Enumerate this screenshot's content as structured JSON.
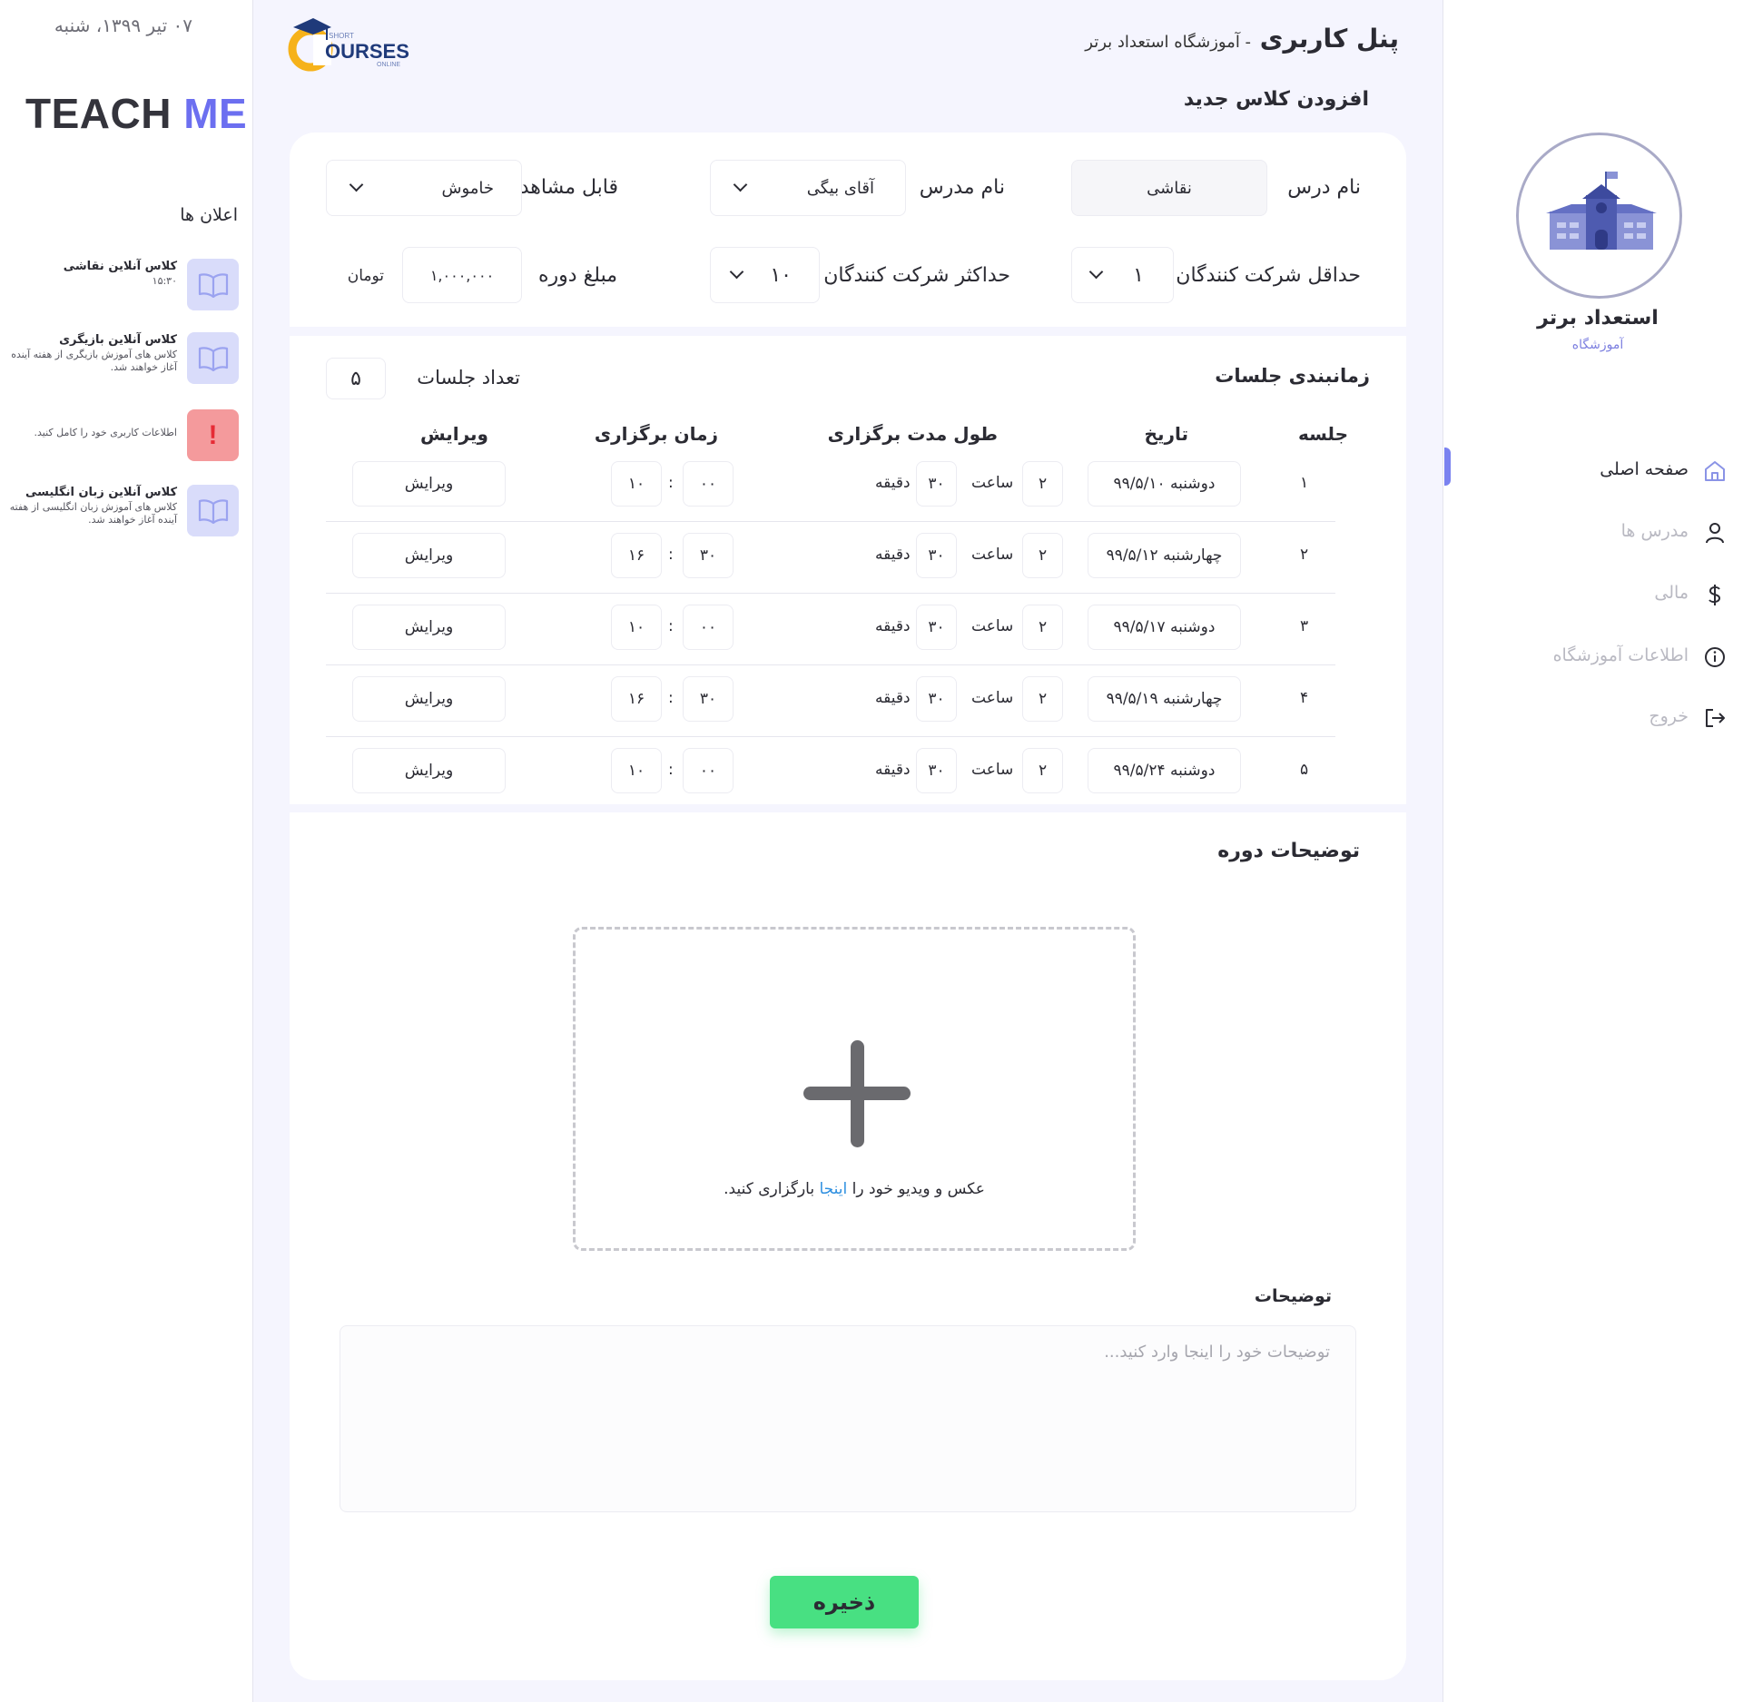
{
  "left": {
    "date": "۰۷ تیر ۱۳۹۹، شنبه",
    "brand": {
      "part1": "TEACH",
      "part2": "ME"
    },
    "announcements_title": "اعلان ها",
    "announcements": [
      {
        "title": "کلاس آنلاین نقاشی",
        "subtitle": "۱۵:۳۰",
        "icon": "book-icon"
      },
      {
        "title": "کلاس آنلاین بازیگری",
        "subtitle": "کلاس های آموزش بازیگری از هفته آینده آغاز خواهند شد.",
        "icon": "book-icon"
      },
      {
        "title": "",
        "subtitle": "اطلاعات کاربری خود را کامل کنید.",
        "icon": "alert-icon"
      },
      {
        "title": "کلاس آنلاین زبان انگلیسی",
        "subtitle": "کلاس های آموزش زبان انگلیسی از هفته آینده آغاز خواهند شد.",
        "icon": "book-icon"
      }
    ]
  },
  "header": {
    "title": "پنل کاربری",
    "subtitle": "- آموزشگاه استعداد برتر",
    "page_title": "افزودن کلاس جدید",
    "logo": {
      "small_top": "SHORT",
      "main": "OURSES",
      "small_bottom": "ONLINE"
    }
  },
  "form": {
    "course_name_label": "نام درس",
    "course_name_value": "نقاشی",
    "teacher_label": "نام مدرس",
    "teacher_value": "آقای بیگی",
    "visibility_label": "قابل مشاهده",
    "visibility_value": "خاموش",
    "min_participants_label": "حداقل شرکت کنندگان",
    "min_participants_value": "۱",
    "max_participants_label": "حداکثر شرکت کنندگان",
    "max_participants_value": "۱۰",
    "price_label": "مبلغ دوره",
    "price_value": "۱,۰۰۰,۰۰۰",
    "currency": "تومان"
  },
  "schedule": {
    "title": "زمانبندی جلسات",
    "count_label": "تعداد جلسات",
    "count_value": "۵",
    "headers": {
      "session": "جلسه",
      "date": "تاریخ",
      "duration": "طول مدت برگزاری",
      "time": "زمان برگزاری",
      "edit": "ویرایش"
    },
    "hour_label": "ساعت",
    "minute_label": "دقیقه",
    "rows": [
      {
        "num": "۱",
        "date": "دوشنبه ۹۹/۵/۱۰",
        "hours": "۲",
        "minutes": "۳۰",
        "time_h": "۱۰",
        "time_m": "۰۰",
        "edit": "ویرایش"
      },
      {
        "num": "۲",
        "date": "چهارشنبه ۹۹/۵/۱۲",
        "hours": "۲",
        "minutes": "۳۰",
        "time_h": "۱۶",
        "time_m": "۳۰",
        "edit": "ویرایش"
      },
      {
        "num": "۳",
        "date": "دوشنبه ۹۹/۵/۱۷",
        "hours": "۲",
        "minutes": "۳۰",
        "time_h": "۱۰",
        "time_m": "۰۰",
        "edit": "ویرایش"
      },
      {
        "num": "۴",
        "date": "چهارشنبه ۹۹/۵/۱۹",
        "hours": "۲",
        "minutes": "۳۰",
        "time_h": "۱۶",
        "time_m": "۳۰",
        "edit": "ویرایش"
      },
      {
        "num": "۵",
        "date": "دوشنبه ۹۹/۵/۲۴",
        "hours": "۲",
        "minutes": "۳۰",
        "time_h": "۱۰",
        "time_m": "۰۰",
        "edit": "ویرایش"
      }
    ]
  },
  "description": {
    "title": "توضیحات دوره",
    "upload_before": "عکس و ویدیو خود را",
    "upload_link": "اینجا",
    "upload_after": "بارگزاری کنید.",
    "notes_label": "توضیحات",
    "notes_placeholder": "توضیحات خود را اینجا وارد کنید...",
    "save_label": "ذخیره"
  },
  "sidebar": {
    "institute_name": "استعداد برتر",
    "institute_type": "آموزشگاه",
    "nav": [
      {
        "label": "صفحه اصلی",
        "icon": "home-icon",
        "active": true
      },
      {
        "label": "مدرس ها",
        "icon": "user-icon",
        "active": false
      },
      {
        "label": "مالی",
        "icon": "dollar-icon",
        "active": false
      },
      {
        "label": "اطلاعات آموزشگاه",
        "icon": "info-icon",
        "active": false
      },
      {
        "label": "خروج",
        "icon": "logout-icon",
        "active": false
      }
    ]
  },
  "colors": {
    "accent": "#6c6ff0",
    "main_bg": "#f5f5fe",
    "save_button": "#48e082",
    "alert": "#f49a9c",
    "announcement_icon_bg": "#d9dcfa"
  }
}
